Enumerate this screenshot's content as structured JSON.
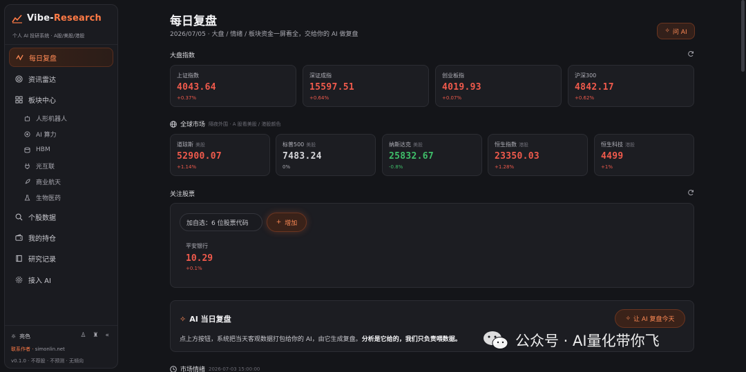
{
  "brand": {
    "name_prefix": "Vibe-",
    "name_accent": "Research",
    "subtitle": "个人 AI 投研系统 · A股/美股/港股"
  },
  "sidebar": {
    "items": [
      {
        "label": "每日复盘",
        "icon": "chart-line-icon"
      },
      {
        "label": "资讯雷达",
        "icon": "radar-icon"
      },
      {
        "label": "板块中心",
        "icon": "grid-icon"
      },
      {
        "label": "个股数据",
        "icon": "search-icon"
      },
      {
        "label": "我的持仓",
        "icon": "wallet-icon"
      },
      {
        "label": "研究记录",
        "icon": "book-icon"
      },
      {
        "label": "接入 AI",
        "icon": "gear-icon"
      }
    ],
    "sub_items": [
      {
        "label": "人形机器人",
        "icon": "robot-icon"
      },
      {
        "label": "AI 算力",
        "icon": "chip-icon"
      },
      {
        "label": "HBM",
        "icon": "database-icon"
      },
      {
        "label": "光互联",
        "icon": "plug-icon"
      },
      {
        "label": "商业航天",
        "icon": "rocket-icon"
      },
      {
        "label": "生物医药",
        "icon": "flask-icon"
      }
    ],
    "theme_label": "亮色",
    "contact_label": "联系作者 · ",
    "contact_link": "simonlin.net",
    "version": "v0.1.0 · 不荐股 · 不预测 · 无倾向"
  },
  "header": {
    "title": "每日复盘",
    "subtitle": "2026/07/05 · 大盘 / 情绪 / 板块资金一屏看全，交给你的 AI 做复盘",
    "ask_ai": "问 AI"
  },
  "market_index": {
    "title": "大盘指数",
    "cards": [
      {
        "name": "上证指数",
        "value": "4043.64",
        "change": "+0.37%",
        "dir": "up"
      },
      {
        "name": "深证成指",
        "value": "15597.51",
        "change": "+0.64%",
        "dir": "up"
      },
      {
        "name": "创业板指",
        "value": "4019.93",
        "change": "+0.07%",
        "dir": "up"
      },
      {
        "name": "沪深300",
        "value": "4842.17",
        "change": "+0.62%",
        "dir": "up"
      }
    ]
  },
  "global_market": {
    "title": "全球市场",
    "hint": "隔夜外围 · A 股看美股 / 港股颜色",
    "cards": [
      {
        "name": "道琼斯",
        "tag": "美股",
        "value": "52900.07",
        "change": "+1.14%",
        "dir": "up"
      },
      {
        "name": "标普500",
        "tag": "美股",
        "value": "7483.24",
        "change": "0%",
        "dir": "flat"
      },
      {
        "name": "纳斯达克",
        "tag": "美股",
        "value": "25832.67",
        "change": "-0.8%",
        "dir": "down"
      },
      {
        "name": "恒生指数",
        "tag": "港股",
        "value": "23350.03",
        "change": "+1.28%",
        "dir": "up"
      },
      {
        "name": "恒生科技",
        "tag": "港股",
        "value": "4499",
        "change": "+1%",
        "dir": "up"
      }
    ]
  },
  "watchlist": {
    "title": "关注股票",
    "input_placeholder": "加自选：6 位股票代码",
    "add_label": "增加",
    "stock": {
      "name": "平安银行",
      "price": "10.29",
      "change": "+0.1%"
    }
  },
  "ai_review": {
    "title": "AI 当日复盘",
    "desc_plain": "点上方按钮，系统把当天客观数据打包给你的 AI，由它生成复盘。",
    "desc_bold": "分析是它给的，我们只负责喂数据。",
    "button": "让 AI 复盘今天"
  },
  "market_mood": {
    "title": "市场情绪",
    "timestamp": "2026-07-03 15:00:00"
  },
  "watermark": {
    "text": "公众号 · AI量化带你飞"
  },
  "colors": {
    "accent": "#ff7a45",
    "up": "#f05a4c",
    "down": "#3fbf6a",
    "bg": "#141519",
    "card": "#1c1d22"
  }
}
